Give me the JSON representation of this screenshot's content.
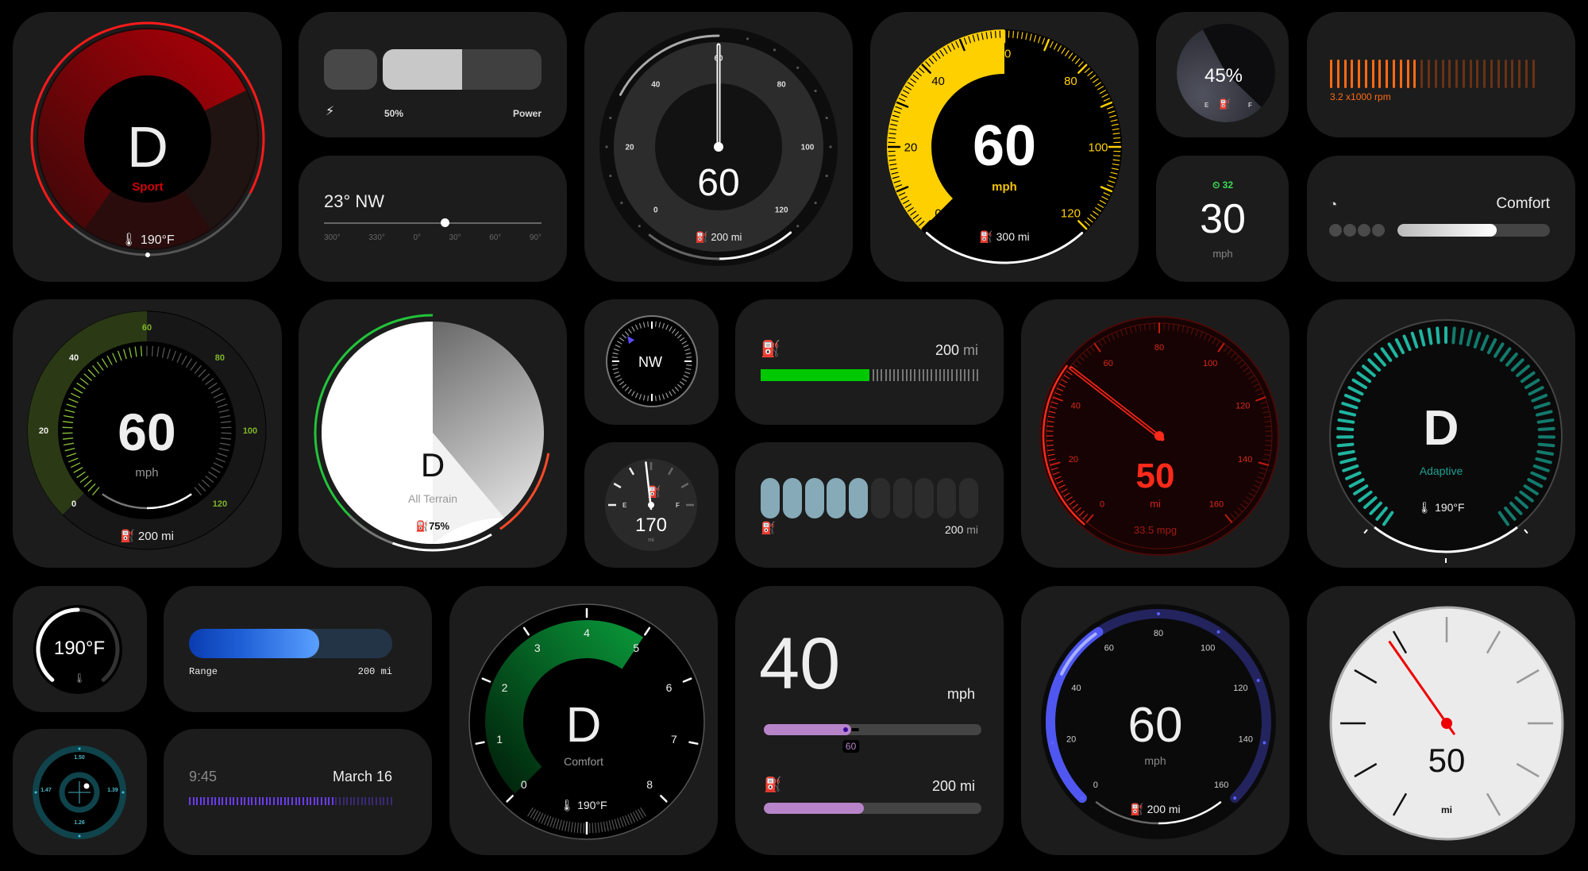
{
  "widgets": {
    "sport_gear": {
      "gear": "D",
      "mode": "Sport",
      "coolant_temp": "190°F",
      "fill_fraction": 0.72,
      "accent": "#e0000b"
    },
    "power_bar": {
      "percent_label": "50%",
      "label": "Power",
      "value_fraction": 0.5,
      "icon": "bolt-icon"
    },
    "wind_slider": {
      "heading": "23° NW",
      "ticks": [
        "300°",
        "330°",
        "0°",
        "30°",
        "60°",
        "90°"
      ],
      "value_deg": 23
    },
    "mono_speedo": {
      "speed": "60",
      "range": "200 mi",
      "ticks": [
        "0",
        "20",
        "40",
        "60",
        "80",
        "100",
        "120"
      ],
      "value": 60,
      "max": 120
    },
    "yellow_speedo": {
      "speed": "60",
      "unit": "mph",
      "range": "300 mi",
      "ticks": [
        "0",
        "20",
        "40",
        "60",
        "80",
        "100",
        "120"
      ],
      "value": 60,
      "max": 120,
      "accent": "#ffd000"
    },
    "fuel_pie": {
      "percent": "45%",
      "empty": "E",
      "full": "F",
      "value_fraction": 0.45
    },
    "rpm_bar": {
      "label": "3.2 x1000 rpm",
      "active_bars": 13,
      "total_bars": 30,
      "accent": "#ff6a13"
    },
    "speed_limit": {
      "limit": "32",
      "speed": "30",
      "unit": "mph",
      "accent": "#3ddc5a"
    },
    "drive_mode": {
      "mode": "Comfort",
      "dots": 4,
      "value_fraction": 0.65
    },
    "green_speedo": {
      "speed": "60",
      "unit": "mph",
      "range": "200 mi",
      "ticks": [
        "0",
        "20",
        "40",
        "60",
        "80",
        "100",
        "120"
      ],
      "value": 60,
      "max": 120,
      "accent": "#7fb52a"
    },
    "all_terrain": {
      "gear": "D",
      "mode": "All Terrain",
      "fuel": "75%"
    },
    "compass": {
      "direction": "NW"
    },
    "fuel_dial": {
      "range": "170",
      "unit": "mi",
      "empty": "E",
      "full": "F"
    },
    "green_range_bar": {
      "range_value": "200",
      "range_unit": "mi",
      "value_fraction": 0.5,
      "accent": "#00c800"
    },
    "pill_range": {
      "range_value": "200",
      "range_unit": "mi",
      "active_pills": 5,
      "total_pills": 10
    },
    "red_odometer": {
      "value": "50",
      "unit": "mi",
      "economy": "33.5 mpg",
      "ticks": [
        "0",
        "20",
        "40",
        "60",
        "80",
        "100",
        "120",
        "140",
        "160"
      ],
      "needle_value": 50,
      "max": 160,
      "accent": "#ff2a1a"
    },
    "adaptive_gear": {
      "gear": "D",
      "mode": "Adaptive",
      "coolant_temp": "190°F",
      "accent": "#1fb5a0"
    },
    "coolant_ring": {
      "temp": "190°F",
      "fill_fraction": 0.5
    },
    "blue_range_bar": {
      "label": "Range",
      "value": "200 mi",
      "fill_fraction": 0.64
    },
    "trim_gauge": {
      "top": "1.50",
      "left": "1.47",
      "right": "1.39",
      "bottom": "1.26"
    },
    "clock_strip": {
      "time": "9:45",
      "date": "March 16",
      "fill_fraction": 0.7,
      "accent": "#6a3cf0"
    },
    "comfort_rpm": {
      "gear": "D",
      "mode": "Comfort",
      "coolant_temp": "190°F",
      "ticks": [
        "0",
        "1",
        "2",
        "3",
        "4",
        "5",
        "6",
        "7",
        "8"
      ],
      "value": 5
    },
    "purple_speed": {
      "speed": "40",
      "unit": "mph",
      "limit": "60",
      "range": "200 mi",
      "speed_fraction": 0.4,
      "range_fraction": 0.46,
      "accent": "#b784c9"
    },
    "blue_speedo": {
      "speed": "60",
      "unit": "mph",
      "range": "200 mi",
      "ticks": [
        "0",
        "20",
        "40",
        "60",
        "80",
        "100",
        "120",
        "140",
        "160"
      ],
      "value": 60,
      "max": 160,
      "accent": "#4f57f0"
    },
    "white_dial": {
      "value": "50",
      "unit": "mi"
    }
  }
}
